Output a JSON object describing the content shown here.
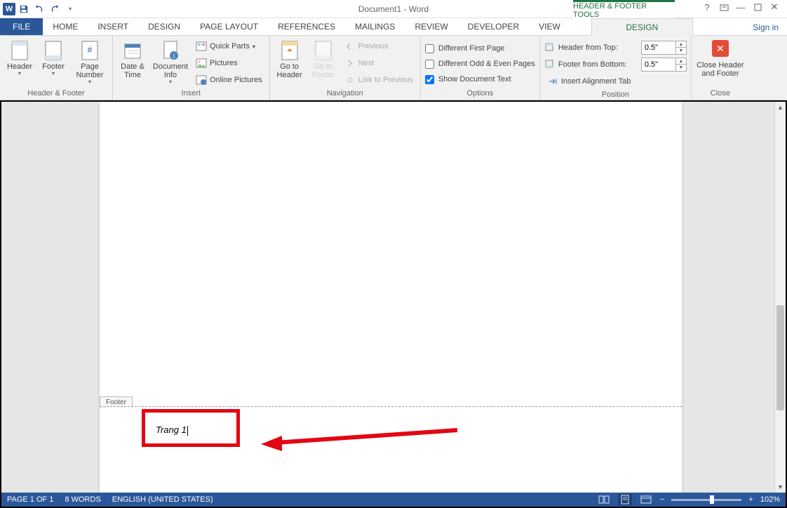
{
  "title": "Document1 - Word",
  "contextual_title": "HEADER & FOOTER TOOLS",
  "signin": "Sign in",
  "tabs": {
    "file": "FILE",
    "home": "HOME",
    "insert": "INSERT",
    "design": "DESIGN",
    "page_layout": "PAGE LAYOUT",
    "references": "REFERENCES",
    "mailings": "MAILINGS",
    "review": "REVIEW",
    "developer": "DEVELOPER",
    "view": "VIEW",
    "design_ctx": "DESIGN"
  },
  "ribbon": {
    "group_hf": {
      "label": "Header & Footer",
      "header": "Header",
      "footer": "Footer",
      "page_number": "Page Number"
    },
    "group_insert": {
      "label": "Insert",
      "date_time": "Date & Time",
      "doc_info": "Document Info",
      "quick_parts": "Quick Parts",
      "pictures": "Pictures",
      "online_pictures": "Online Pictures"
    },
    "group_nav": {
      "label": "Navigation",
      "goto_header": "Go to Header",
      "goto_footer": "Go to Footer",
      "previous": "Previous",
      "next": "Next",
      "link_prev": "Link to Previous"
    },
    "group_options": {
      "label": "Options",
      "diff_first": "Different First Page",
      "diff_odd_even": "Different Odd & Even Pages",
      "show_doc": "Show Document Text"
    },
    "group_position": {
      "label": "Position",
      "header_top": "Header from Top:",
      "footer_bottom": "Footer from Bottom:",
      "insert_align": "Insert Alignment Tab",
      "val_top": "0.5\"",
      "val_bottom": "0.5\""
    },
    "group_close": {
      "label": "Close",
      "close_btn": "Close Header and Footer"
    }
  },
  "document": {
    "footer_tab": "Footer",
    "footer_text": "Trang 1"
  },
  "statusbar": {
    "page": "PAGE 1 OF 1",
    "words": "8 WORDS",
    "lang": "ENGLISH (UNITED STATES)",
    "zoom": "102%"
  }
}
